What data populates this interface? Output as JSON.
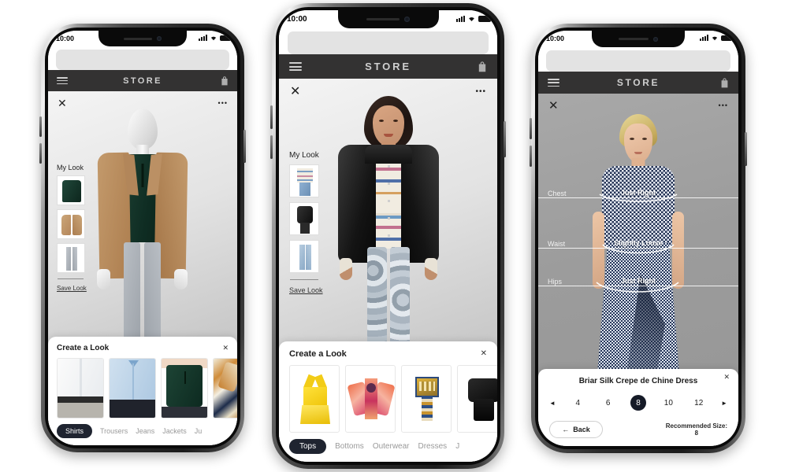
{
  "app": {
    "store_title": "STORE",
    "status_time": "10:00",
    "close_label": "✕",
    "more_label": "•••",
    "sheet_close": "✕",
    "plus_label": "+"
  },
  "phones": [
    {
      "id": "phone-menswear",
      "status_time": "10:00",
      "store_title": "STORE",
      "mylook": {
        "title": "My Look",
        "save_label": "Save Look",
        "items": [
          {
            "name": "green-polo-shirt"
          },
          {
            "name": "tan-blazer"
          },
          {
            "name": "grey-trousers"
          }
        ]
      },
      "sheet": {
        "title": "Create a Look",
        "close": "✕",
        "products": [
          {
            "name": "white-dress-shirt"
          },
          {
            "name": "light-blue-dress-shirt"
          },
          {
            "name": "green-polo-shirt"
          },
          {
            "name": "printed-scarf-shirt"
          }
        ],
        "tabs": [
          {
            "label": "Shirts",
            "active": true
          },
          {
            "label": "Trousers",
            "active": false
          },
          {
            "label": "Jeans",
            "active": false
          },
          {
            "label": "Jackets",
            "active": false
          },
          {
            "label": "Ju",
            "active": false
          }
        ]
      }
    },
    {
      "id": "phone-womenswear",
      "status_time": "10:00",
      "store_title": "STORE",
      "mylook": {
        "title": "My Look",
        "save_label": "Save Look",
        "items": [
          {
            "name": "striped-sweater-and-jeans"
          },
          {
            "name": "black-leather-jacket-outfit"
          },
          {
            "name": "light-wash-jeans"
          }
        ]
      },
      "sheet": {
        "title": "Create a Look",
        "close": "✕",
        "products": [
          {
            "name": "yellow-lace-camisole"
          },
          {
            "name": "orange-floral-kimono-top"
          },
          {
            "name": "embroidered-crop-top"
          },
          {
            "name": "black-long-sleeve-top"
          }
        ],
        "tabs": [
          {
            "label": "Tops",
            "active": true
          },
          {
            "label": "Bottoms",
            "active": false
          },
          {
            "label": "Outerwear",
            "active": false
          },
          {
            "label": "Dresses",
            "active": false
          },
          {
            "label": "J",
            "active": false
          }
        ]
      }
    },
    {
      "id": "phone-fit-size",
      "status_time": "10:00",
      "store_title": "STORE",
      "fit": [
        {
          "label": "Chest",
          "value": "Just Right"
        },
        {
          "label": "Waist",
          "value": "Slightly Loose"
        },
        {
          "label": "Hips",
          "value": "Just Right"
        }
      ],
      "sheet": {
        "title": "Briar Silk Crepe de Chine Dress",
        "close": "✕",
        "prev_arrow": "◄",
        "next_arrow": "►",
        "sizes": [
          {
            "label": "4",
            "selected": false
          },
          {
            "label": "6",
            "selected": false
          },
          {
            "label": "8",
            "selected": true
          },
          {
            "label": "10",
            "selected": false
          },
          {
            "label": "12",
            "selected": false
          }
        ],
        "back_label": "Back",
        "back_arrow": "←",
        "recommended_label": "Recommended Size:",
        "recommended_value": "8"
      }
    }
  ],
  "colors": {
    "nav_bar": "#333232",
    "nav_text": "#cfcfcf",
    "active_tab": "#1f2430",
    "selected_size": "#151a27",
    "url_pill": "#e3e3e3"
  }
}
